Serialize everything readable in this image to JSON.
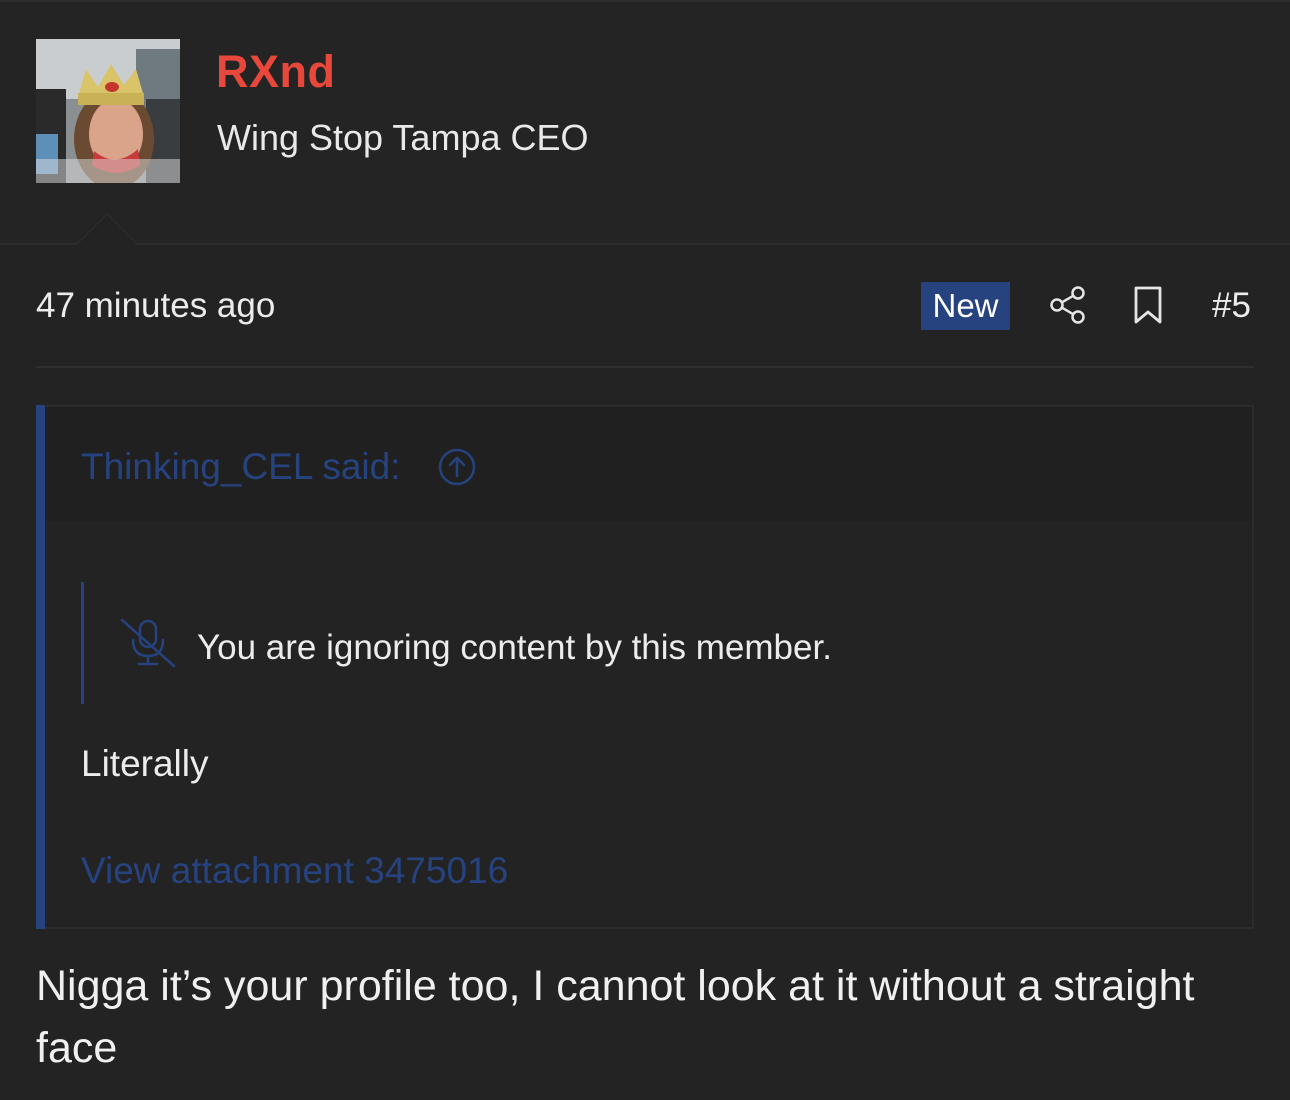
{
  "user": {
    "name": "RXnd",
    "title": "Wing Stop Tampa CEO"
  },
  "meta": {
    "time": "47 minutes ago",
    "badge": "New",
    "post_number": "#5",
    "icons": [
      "share-icon",
      "bookmark-icon"
    ]
  },
  "quote": {
    "author": "Thinking_CEL said:",
    "ignored_notice": "You are ignoring content by this member.",
    "body": "Literally",
    "attachment": "View attachment 3475016"
  },
  "reply": {
    "body": "Nigga it’s your profile too, I cannot look at it without a straight face"
  },
  "colors": {
    "background": "#232323",
    "username": "#e8483b",
    "accent": "#26437f",
    "text": "#ececec"
  }
}
